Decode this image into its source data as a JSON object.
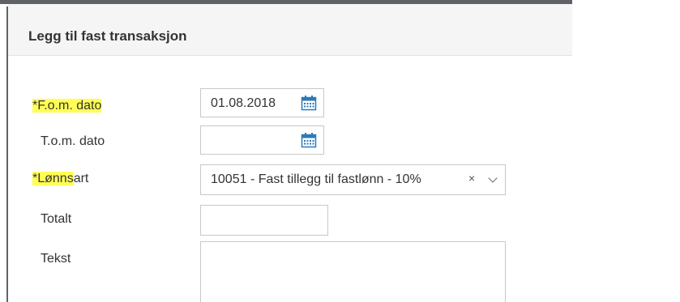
{
  "background": {
    "snippet": "ato"
  },
  "dialog": {
    "title": "Legg til fast transaksjon"
  },
  "form": {
    "fom_date": {
      "required_marker": "*",
      "label_highlighted": "F.o.m. dato",
      "label_rest": "",
      "value": "01.08.2018",
      "icon": "calendar-icon"
    },
    "tom_date": {
      "label": "T.o.m. dato",
      "value": "",
      "icon": "calendar-icon"
    },
    "lonnsart": {
      "required_marker": "*",
      "label_highlighted": "Lønns",
      "label_rest": "art",
      "value": "10051 - Fast tillegg til fastlønn - 10%",
      "clear_symbol": "×",
      "icon": "chevron-down-icon"
    },
    "totalt": {
      "label": "Totalt",
      "value": ""
    },
    "tekst": {
      "label": "Tekst",
      "value": ""
    }
  },
  "colors": {
    "highlight": "#ffff55",
    "calendar_blue": "#2a7ab8",
    "header_bg": "#f5f5f5"
  }
}
